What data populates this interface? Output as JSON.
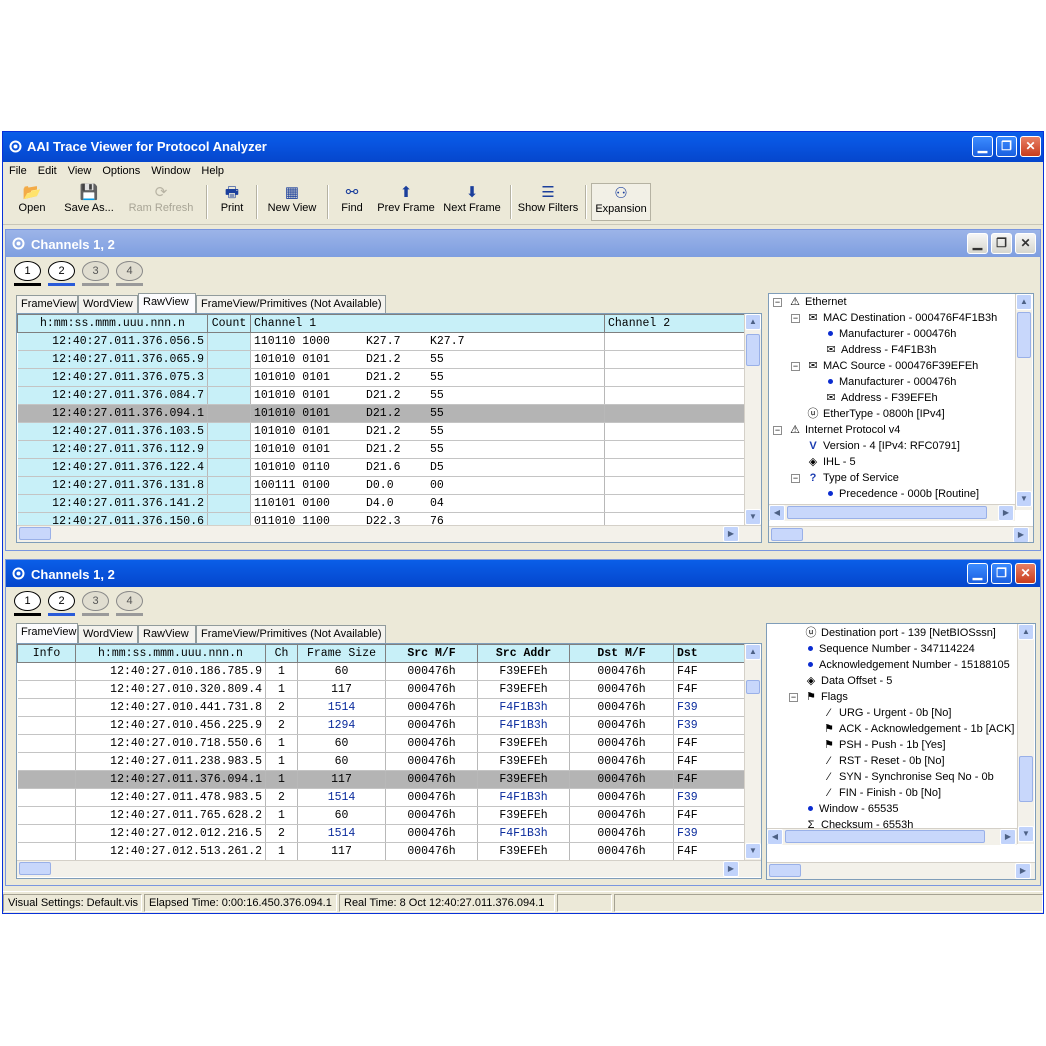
{
  "app": {
    "title": "AAI Trace Viewer for Protocol Analyzer"
  },
  "menu": [
    "File",
    "Edit",
    "View",
    "Options",
    "Window",
    "Help"
  ],
  "toolbar": [
    {
      "label": "Open",
      "icon": "open-folder-icon",
      "glyph": "📂"
    },
    {
      "label": "Save As...",
      "icon": "floppy-disk-icon",
      "glyph": "💾"
    },
    {
      "label": "Ram Refresh",
      "icon": "refresh-icon",
      "glyph": "⟳"
    },
    {
      "label": "Print",
      "icon": "printer-icon",
      "glyph": "🖶"
    },
    {
      "label": "New View",
      "icon": "new-view-icon",
      "glyph": "▦"
    },
    {
      "label": "Find",
      "icon": "binoculars-icon",
      "glyph": "⚯"
    },
    {
      "label": "Prev Frame",
      "icon": "arrow-up-icon",
      "glyph": "⬆"
    },
    {
      "label": "Next Frame",
      "icon": "arrow-down-icon",
      "glyph": "⬇"
    },
    {
      "label": "Show Filters",
      "icon": "filter-list-icon",
      "glyph": "☰"
    },
    {
      "label": "Expansion",
      "icon": "expansion-tree-icon",
      "glyph": "⚇"
    }
  ],
  "win1": {
    "title": "Channels 1, 2",
    "channels": [
      "1",
      "2",
      "3",
      "4"
    ],
    "tabs": [
      "FrameView",
      "WordView",
      "RawView",
      "FrameView/Primitives (Not Available)"
    ],
    "columns": [
      "h:mm:ss.mmm.uuu.nnn.n",
      "Count",
      "Channel 1",
      "Channel 2"
    ],
    "rows": [
      {
        "ts": "12:40:27.011.376.056.5",
        "bits": "110110 1000",
        "code": "K27.7",
        "val": "K27.7"
      },
      {
        "ts": "12:40:27.011.376.065.9",
        "bits": "101010 0101",
        "code": "D21.2",
        "val": "55"
      },
      {
        "ts": "12:40:27.011.376.075.3",
        "bits": "101010 0101",
        "code": "D21.2",
        "val": "55"
      },
      {
        "ts": "12:40:27.011.376.084.7",
        "bits": "101010 0101",
        "code": "D21.2",
        "val": "55"
      },
      {
        "ts": "12:40:27.011.376.094.1",
        "bits": "101010 0101",
        "code": "D21.2",
        "val": "55"
      },
      {
        "ts": "12:40:27.011.376.103.5",
        "bits": "101010 0101",
        "code": "D21.2",
        "val": "55"
      },
      {
        "ts": "12:40:27.011.376.112.9",
        "bits": "101010 0101",
        "code": "D21.2",
        "val": "55"
      },
      {
        "ts": "12:40:27.011.376.122.4",
        "bits": "101010 0110",
        "code": "D21.6",
        "val": "D5"
      },
      {
        "ts": "12:40:27.011.376.131.8",
        "bits": "100111 0100",
        "code": "D0.0",
        "val": "00"
      },
      {
        "ts": "12:40:27.011.376.141.2",
        "bits": "110101 0100",
        "code": "D4.0",
        "val": "04"
      },
      {
        "ts": "12:40:27.011.376.150.6",
        "bits": "011010 1100",
        "code": "D22.3",
        "val": "76"
      }
    ],
    "tree": [
      {
        "text": "Ethernet",
        "icon": "warning-triangle-icon"
      },
      {
        "text": "MAC Destination - 000476F4F1B3h",
        "icon": "envelope-icon"
      },
      {
        "text": "Manufacturer - 000476h",
        "icon": "bullet-icon"
      },
      {
        "text": "Address - F4F1B3h",
        "icon": "envelope-arrow-icon"
      },
      {
        "text": "MAC Source - 000476F39EFEh",
        "icon": "envelope-icon"
      },
      {
        "text": "Manufacturer - 000476h",
        "icon": "bullet-icon"
      },
      {
        "text": "Address - F39EFEh",
        "icon": "envelope-arrow-icon"
      },
      {
        "text": "EtherType - 0800h [IPv4]",
        "icon": "uint-icon"
      },
      {
        "text": "Internet Protocol v4",
        "icon": "warning-triangle-icon"
      },
      {
        "text": "Version - 4 [IPv4: RFC0791]",
        "icon": "v-icon"
      },
      {
        "text": "IHL - 5",
        "icon": "diamond-question-icon"
      },
      {
        "text": "Type of Service",
        "icon": "question-icon"
      },
      {
        "text": "Precedence - 000b [Routine]",
        "icon": "bullet-icon"
      }
    ]
  },
  "win2": {
    "title": "Channels 1, 2",
    "channels": [
      "1",
      "2",
      "3",
      "4"
    ],
    "tabs": [
      "FrameView",
      "WordView",
      "RawView",
      "FrameView/Primitives (Not Available)"
    ],
    "columns": [
      "Info",
      "h:mm:ss.mmm.uuu.nnn.n",
      "Ch",
      "Frame Size",
      "Src M/F",
      "Src Addr",
      "Dst M/F",
      "Dst"
    ],
    "rows": [
      {
        "ts": "12:40:27.010.186.785.9",
        "ch": "1",
        "size": "60",
        "srcmf": "000476h",
        "src": "F39EFEh",
        "dstmf": "000476h",
        "dst": "F4F"
      },
      {
        "ts": "12:40:27.010.320.809.4",
        "ch": "1",
        "size": "117",
        "srcmf": "000476h",
        "src": "F39EFEh",
        "dstmf": "000476h",
        "dst": "F4F"
      },
      {
        "ts": "12:40:27.010.441.731.8",
        "ch": "2",
        "size": "1514",
        "srcmf": "000476h",
        "src": "F4F1B3h",
        "dstmf": "000476h",
        "dst": "F39"
      },
      {
        "ts": "12:40:27.010.456.225.9",
        "ch": "2",
        "size": "1294",
        "srcmf": "000476h",
        "src": "F4F1B3h",
        "dstmf": "000476h",
        "dst": "F39"
      },
      {
        "ts": "12:40:27.010.718.550.6",
        "ch": "1",
        "size": "60",
        "srcmf": "000476h",
        "src": "F39EFEh",
        "dstmf": "000476h",
        "dst": "F4F"
      },
      {
        "ts": "12:40:27.011.238.983.5",
        "ch": "1",
        "size": "60",
        "srcmf": "000476h",
        "src": "F39EFEh",
        "dstmf": "000476h",
        "dst": "F4F"
      },
      {
        "ts": "12:40:27.011.376.094.1",
        "ch": "1",
        "size": "117",
        "srcmf": "000476h",
        "src": "F39EFEh",
        "dstmf": "000476h",
        "dst": "F4F"
      },
      {
        "ts": "12:40:27.011.478.983.5",
        "ch": "2",
        "size": "1514",
        "srcmf": "000476h",
        "src": "F4F1B3h",
        "dstmf": "000476h",
        "dst": "F39"
      },
      {
        "ts": "12:40:27.011.765.628.2",
        "ch": "1",
        "size": "60",
        "srcmf": "000476h",
        "src": "F39EFEh",
        "dstmf": "000476h",
        "dst": "F4F"
      },
      {
        "ts": "12:40:27.012.012.216.5",
        "ch": "2",
        "size": "1514",
        "srcmf": "000476h",
        "src": "F4F1B3h",
        "dstmf": "000476h",
        "dst": "F39"
      },
      {
        "ts": "12:40:27.012.513.261.2",
        "ch": "1",
        "size": "117",
        "srcmf": "000476h",
        "src": "F39EFEh",
        "dstmf": "000476h",
        "dst": "F4F"
      }
    ],
    "tree": [
      {
        "text": "Destination port - 139 [NetBIOSssn]",
        "icon": "uint-icon"
      },
      {
        "text": "Sequence Number - 347114224",
        "icon": "bullet-icon"
      },
      {
        "text": "Acknowledgement Number - 15188105",
        "icon": "bullet-icon"
      },
      {
        "text": "Data Offset - 5",
        "icon": "diamond-question-icon"
      },
      {
        "text": "Flags",
        "icon": "flags-icon"
      },
      {
        "text": "URG - Urgent - 0b [No]",
        "icon": "flag-down-icon"
      },
      {
        "text": "ACK - Acknowledgement - 1b [ACK]",
        "icon": "flag-up-icon"
      },
      {
        "text": "PSH - Push - 1b [Yes]",
        "icon": "flag-up-icon"
      },
      {
        "text": "RST - Reset - 0b [No]",
        "icon": "flag-down-icon"
      },
      {
        "text": "SYN - Synchronise Seq No - 0b",
        "icon": "flag-down-icon"
      },
      {
        "text": "FIN - Finish - 0b [No]",
        "icon": "flag-down-icon"
      },
      {
        "text": "Window - 65535",
        "icon": "bullet-icon"
      },
      {
        "text": "Checksum - 6553h",
        "icon": "checksum-icon"
      }
    ]
  },
  "status": {
    "visual": "Visual Settings:  Default.vis",
    "elapsed": "Elapsed Time:  0:00:16.450.376.094.1",
    "real": "Real Time:  8 Oct  12:40:27.011.376.094.1"
  },
  "colors": {
    "accent": "#0a5ee8",
    "header_cyan": "#c8f0f8",
    "selected_row": "#b4b4b4",
    "chan1_bar": "#000000",
    "chan2_bar": "#2a5bd7"
  }
}
